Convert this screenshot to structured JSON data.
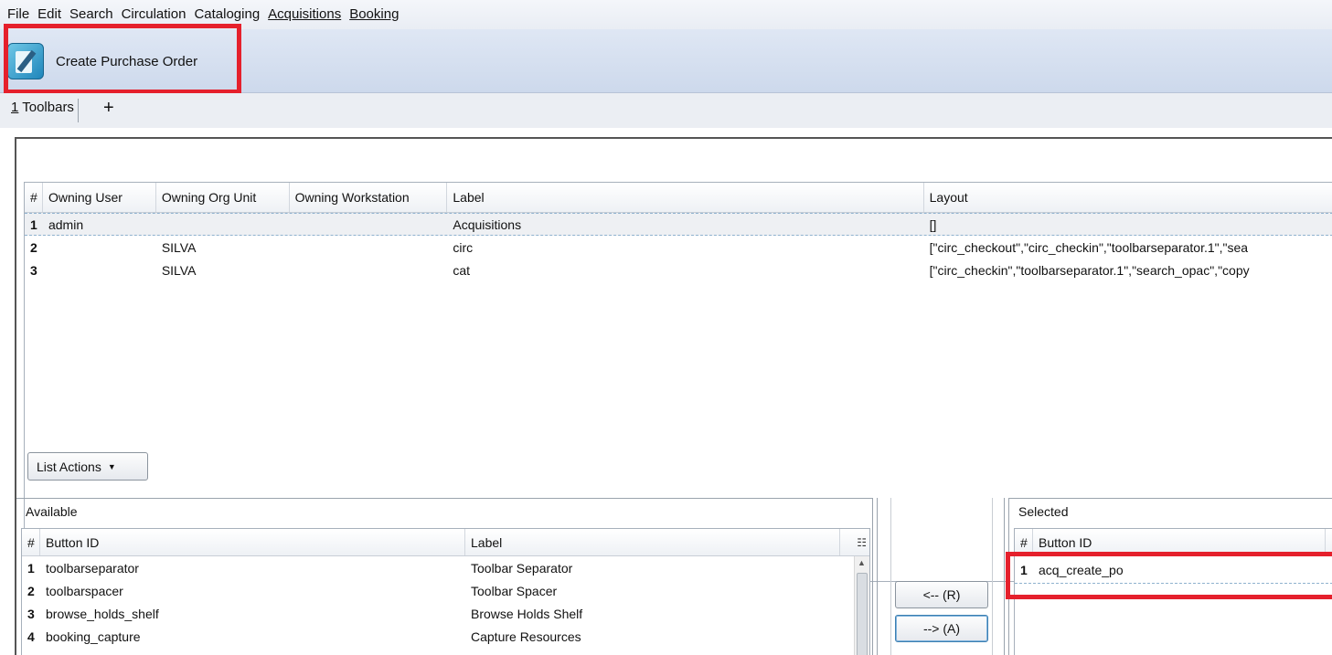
{
  "menu": [
    {
      "label": "File",
      "ul": false
    },
    {
      "label": "Edit",
      "ul": false
    },
    {
      "label": "Search",
      "ul": false
    },
    {
      "label": "Circulation",
      "ul": false
    },
    {
      "label": "Cataloging",
      "ul": false
    },
    {
      "label": "Acquisitions",
      "ul": true
    },
    {
      "label": "Booking",
      "ul": true
    }
  ],
  "toolbar": {
    "button_label": "Create Purchase Order",
    "icon": "create-po-icon"
  },
  "tabs": {
    "current_num": "1",
    "current_label": " Toolbars",
    "add_label": "+"
  },
  "toolbars_grid": {
    "headers": [
      "#",
      "Owning User",
      "Owning Org Unit",
      "Owning Workstation",
      "Label",
      "Layout"
    ],
    "rows": [
      {
        "num": "1",
        "user": "admin",
        "org": "",
        "ws": "",
        "label": "Acquisitions",
        "layout": "[]"
      },
      {
        "num": "2",
        "user": "",
        "org": "SILVA",
        "ws": "",
        "label": "circ",
        "layout": "[\"circ_checkout\",\"circ_checkin\",\"toolbarseparator.1\",\"sea"
      },
      {
        "num": "3",
        "user": "",
        "org": "SILVA",
        "ws": "",
        "label": "cat",
        "layout": "[\"circ_checkin\",\"toolbarseparator.1\",\"search_opac\",\"copy"
      }
    ]
  },
  "list_actions_label": "List Actions",
  "available": {
    "title": "Available",
    "headers": [
      "#",
      "Button ID",
      "Label"
    ],
    "rows": [
      {
        "num": "1",
        "id": "toolbarseparator",
        "label": "Toolbar Separator"
      },
      {
        "num": "2",
        "id": "toolbarspacer",
        "label": "Toolbar Spacer"
      },
      {
        "num": "3",
        "id": "browse_holds_shelf",
        "label": "Browse Holds Shelf"
      },
      {
        "num": "4",
        "id": "booking_capture",
        "label": "Capture Resources"
      }
    ]
  },
  "move_buttons": {
    "remove_label": "<-- (R)",
    "add_label": "--> (A)"
  },
  "selected": {
    "title": "Selected",
    "headers": [
      "#",
      "Button ID"
    ],
    "rows": [
      {
        "num": "1",
        "id": "acq_create_po"
      }
    ]
  },
  "colors": {
    "highlight_box": "#e5202c",
    "toolbar_bg": "#cdd9ec"
  }
}
